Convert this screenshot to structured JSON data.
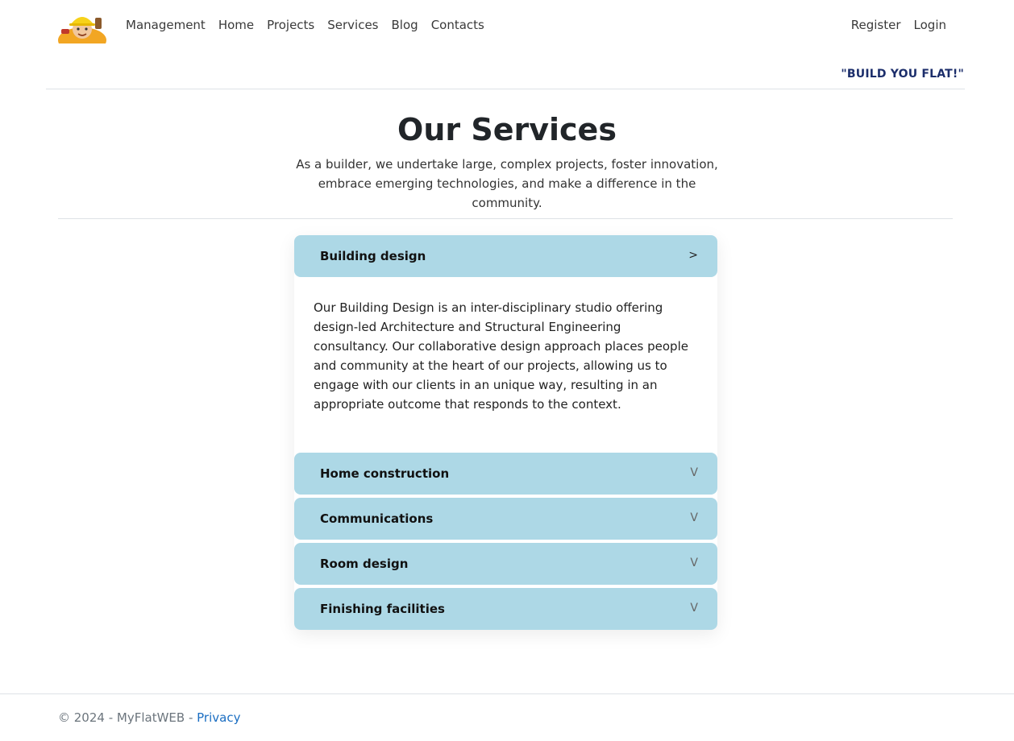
{
  "brand": {
    "logo_icon": "builder-mascot-icon"
  },
  "nav": {
    "items": [
      {
        "label": "Management"
      },
      {
        "label": "Home"
      },
      {
        "label": "Projects"
      },
      {
        "label": "Services"
      },
      {
        "label": "Blog"
      },
      {
        "label": "Contacts"
      }
    ],
    "register": "Register",
    "login": "Login"
  },
  "tagline": "\"BUILD YOU FLAT!\"",
  "hero": {
    "title": "Our Services",
    "lead": "As a builder, we undertake large, complex projects, foster innovation, embrace emerging technologies, and make a difference in the community."
  },
  "accordion": {
    "items": [
      {
        "title": "Building design",
        "chevron": ">",
        "expanded": true,
        "body": "Our Building Design is an inter-disciplinary studio offering design-led Architecture and Structural Engineering consultancy. Our collaborative design approach places people and community at the heart of our projects, allowing  us to engage with our clients in an unique way, resulting in an appropriate outcome that responds to the context."
      },
      {
        "title": "Home construction",
        "chevron": "V",
        "expanded": false
      },
      {
        "title": "Communications",
        "chevron": "V",
        "expanded": false
      },
      {
        "title": "Room design",
        "chevron": "V",
        "expanded": false
      },
      {
        "title": "Finishing facilities",
        "chevron": "V",
        "expanded": false
      }
    ]
  },
  "footer": {
    "copyright": "© 2024 - MyFlatWEB - ",
    "privacy": "Privacy"
  },
  "colors": {
    "accordion_header": "#add8e6",
    "tagline": "#1c2e6b",
    "link": "#1b6ec2"
  }
}
